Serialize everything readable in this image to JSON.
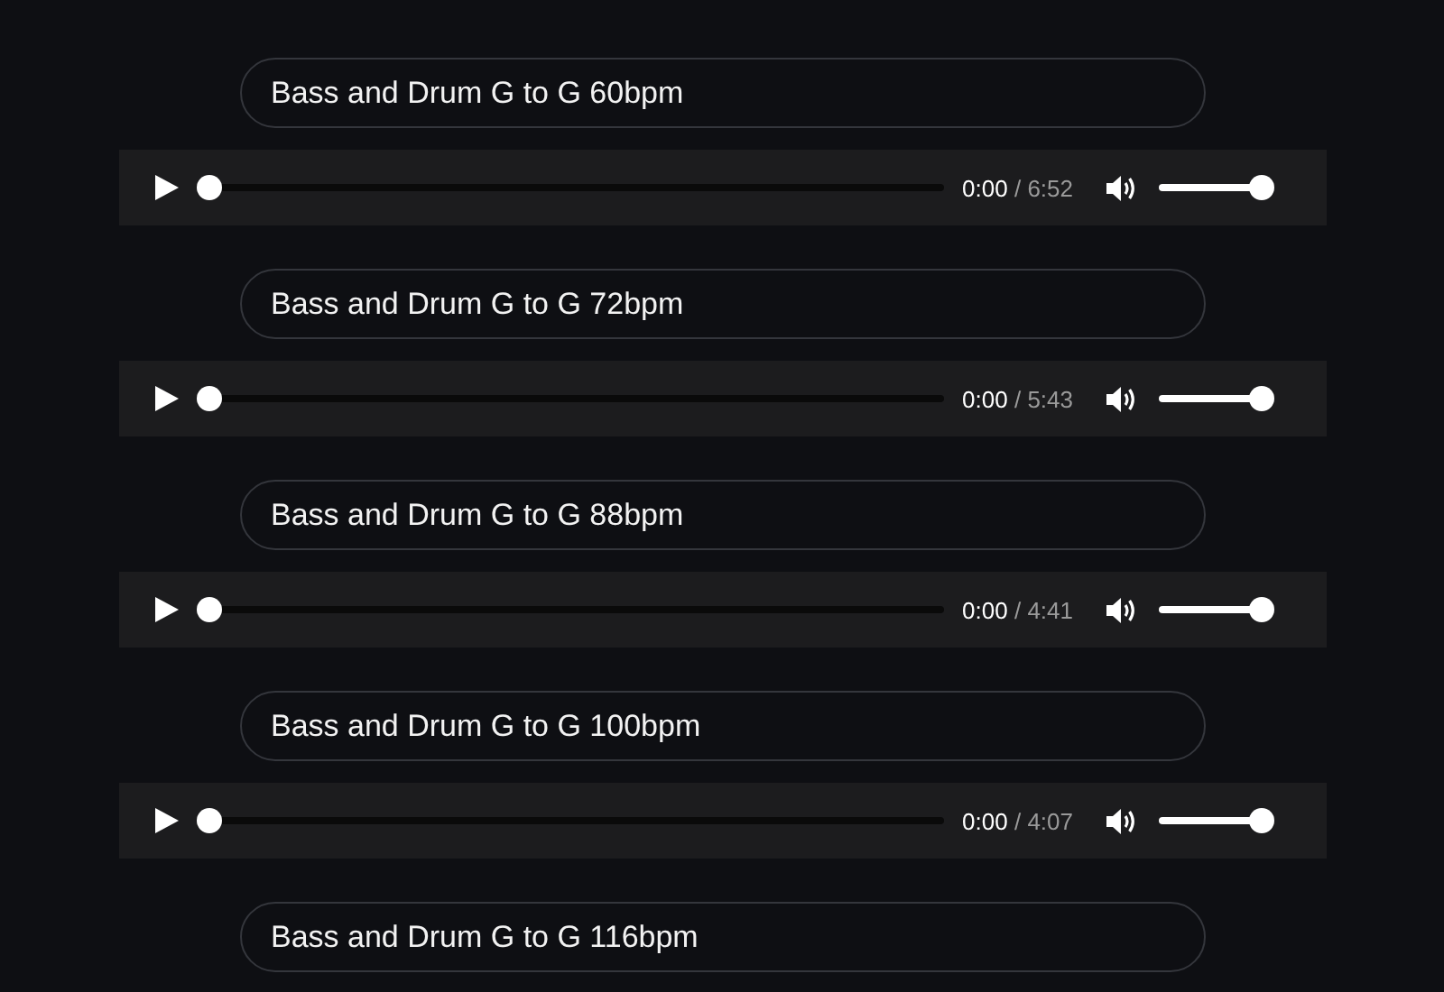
{
  "tracks": [
    {
      "title": "Bass and Drum G to G 60bpm",
      "player": {
        "current": "0:00",
        "separator": "/",
        "duration": "6:52",
        "progress": {
          "level": 0
        },
        "volume": {
          "level": 1
        }
      }
    },
    {
      "title": "Bass and Drum G to G 72bpm",
      "player": {
        "current": "0:00",
        "separator": "/",
        "duration": "5:43",
        "progress": {
          "level": 0
        },
        "volume": {
          "level": 1
        }
      }
    },
    {
      "title": "Bass and Drum G to G 88bpm",
      "player": {
        "current": "0:00",
        "separator": "/",
        "duration": "4:41",
        "progress": {
          "level": 0
        },
        "volume": {
          "level": 1
        }
      }
    },
    {
      "title": "Bass and Drum G to G 100bpm",
      "player": {
        "current": "0:00",
        "separator": "/",
        "duration": "4:07",
        "progress": {
          "level": 0
        },
        "volume": {
          "level": 1
        }
      }
    },
    {
      "title": "Bass and Drum G to G 116bpm"
    }
  ]
}
